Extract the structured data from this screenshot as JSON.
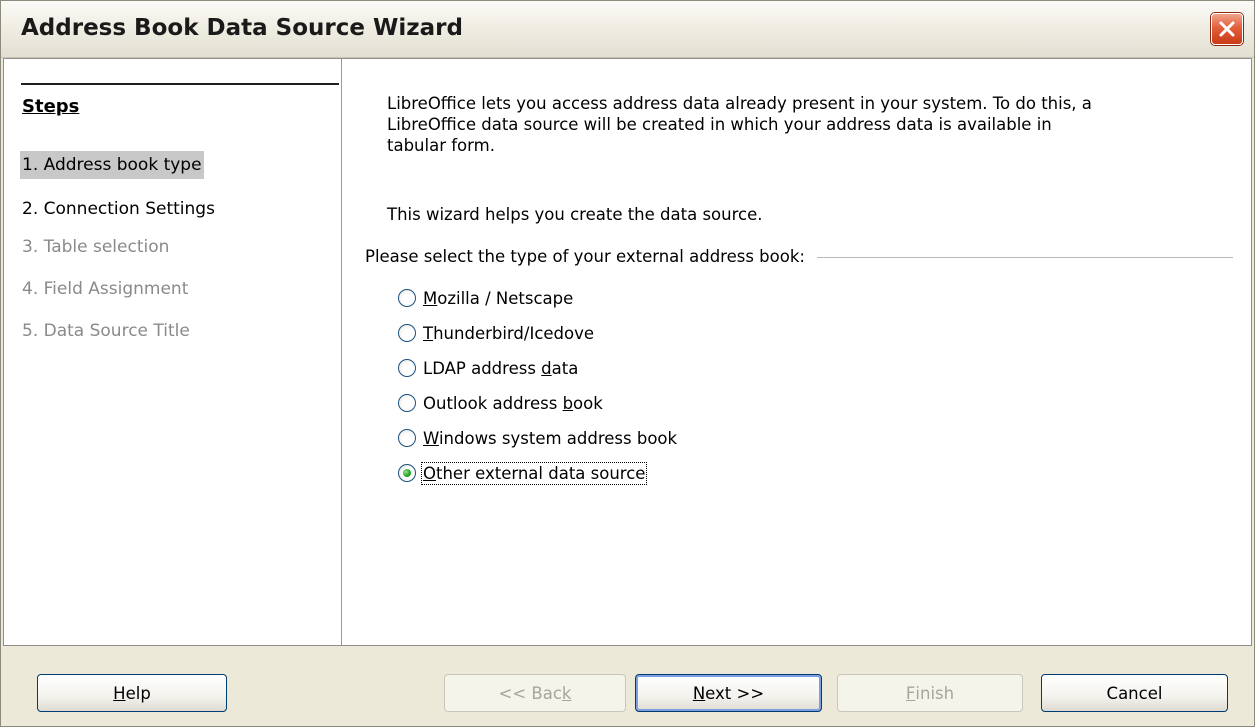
{
  "window": {
    "title": "Address Book Data Source Wizard"
  },
  "steps": {
    "title": "Steps",
    "items": [
      {
        "label": "1. Address book type",
        "state": "current"
      },
      {
        "label": "2. Connection Settings",
        "state": "enabled"
      },
      {
        "label": "3. Table selection",
        "state": "disabled"
      },
      {
        "label": "4. Field Assignment",
        "state": "disabled"
      },
      {
        "label": "5. Data Source Title",
        "state": "disabled"
      }
    ]
  },
  "main": {
    "intro_line1": "LibreOffice lets you access address data already present in your system. To do this, a",
    "intro_line2": "LibreOffice data source will be created in which your address data is available in",
    "intro_line3": "tabular form.",
    "intro2": "This wizard helps you create the data source.",
    "group_label": "Please select the type of your external address book:",
    "options": [
      {
        "pre": "",
        "accel": "M",
        "post": "ozilla / Netscape",
        "checked": false
      },
      {
        "pre": "",
        "accel": "T",
        "post": "hunderbird/Icedove",
        "checked": false
      },
      {
        "pre": "LDAP address ",
        "accel": "d",
        "post": "ata",
        "checked": false
      },
      {
        "pre": "Outlook address ",
        "accel": "b",
        "post": "ook",
        "checked": false
      },
      {
        "pre": "",
        "accel": "W",
        "post": "indows system address book",
        "checked": false
      },
      {
        "pre": "",
        "accel": "O",
        "post": "ther external data source",
        "checked": true
      }
    ]
  },
  "buttons": {
    "help": {
      "accel": "H",
      "post": "elp"
    },
    "back": {
      "pre": "<< Bac",
      "accel": "k",
      "post": ""
    },
    "next": {
      "accel": "N",
      "post": "ext >>"
    },
    "finish": {
      "accel": "F",
      "post": "inish"
    },
    "cancel": {
      "label": "Cancel"
    }
  },
  "colors": {
    "titlebar": "#eeebe0",
    "close_button": "#e2603d",
    "current_step_highlight": "#c8c8c8",
    "disabled_text": "#8a8a8a",
    "radio_checked": "#21a121"
  }
}
